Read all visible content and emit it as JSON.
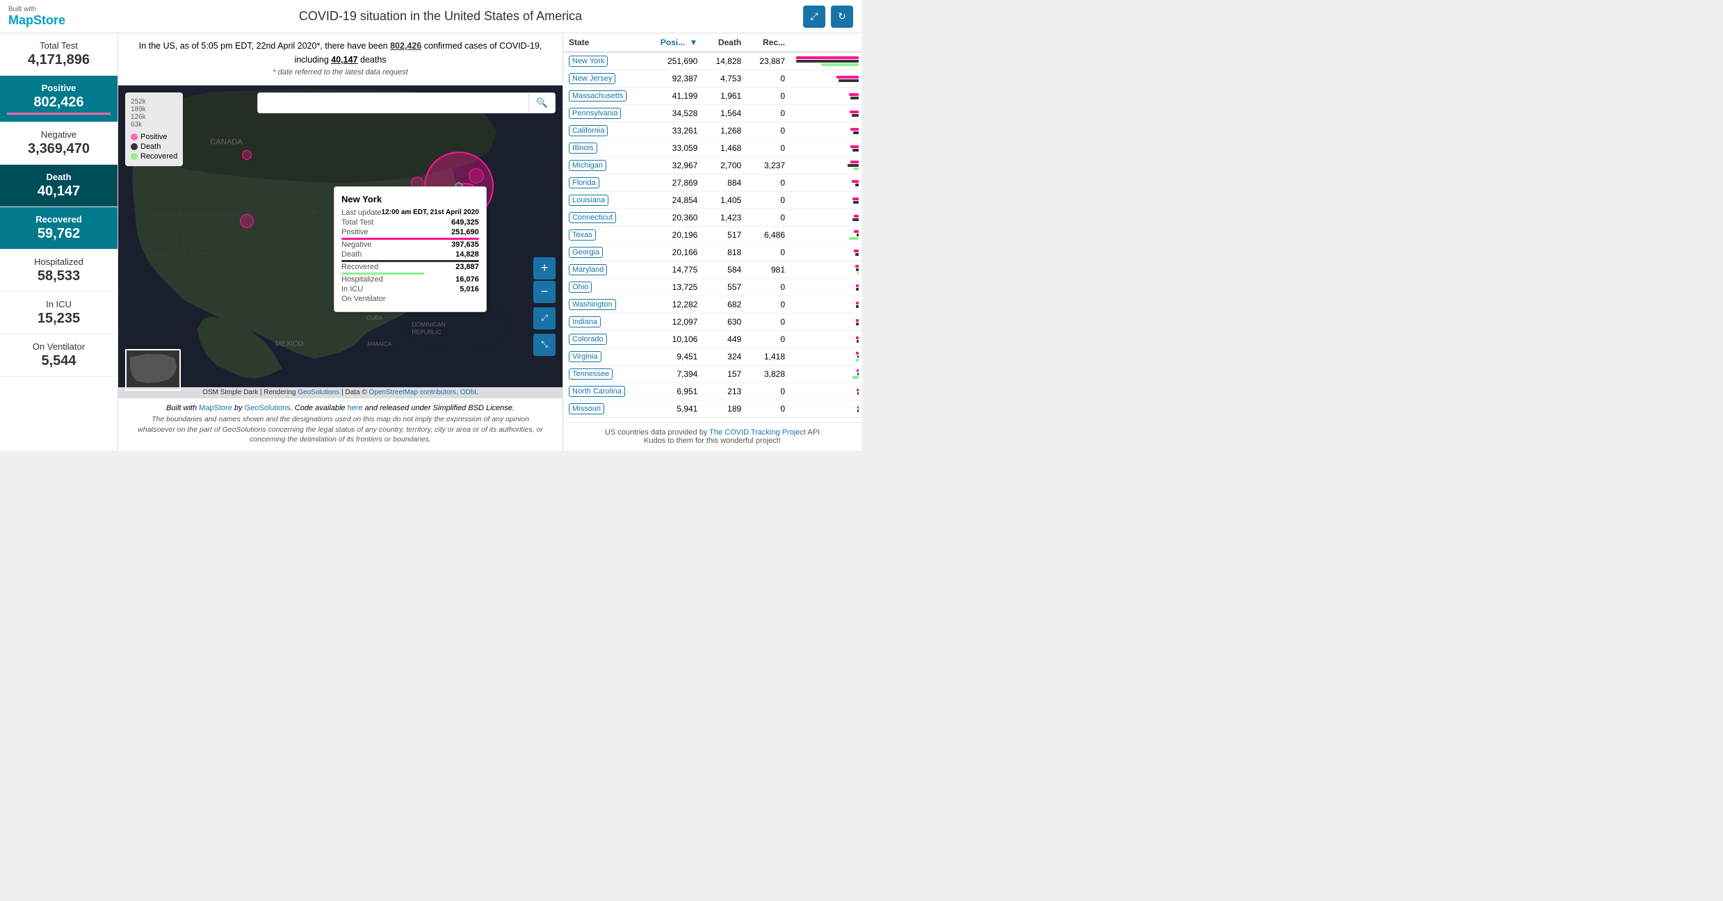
{
  "header": {
    "logo_built": "Built with",
    "logo_name": "MapStore",
    "title": "COVID-19 situation in the United States of America",
    "share_icon": "⤢",
    "refresh_icon": "↻"
  },
  "sidebar": {
    "stats": [
      {
        "label": "Total Test",
        "value": "4,171,896",
        "type": "white"
      },
      {
        "label": "Positive",
        "value": "802,426",
        "type": "teal",
        "accent": "#ff69b4"
      },
      {
        "label": "Negative",
        "value": "3,369,470",
        "type": "white"
      },
      {
        "label": "Death",
        "value": "40,147",
        "type": "dark-teal"
      },
      {
        "label": "Recovered",
        "value": "59,762",
        "type": "teal"
      },
      {
        "label": "Hospitalized",
        "value": "58,533",
        "type": "white"
      },
      {
        "label": "In ICU",
        "value": "15,235",
        "type": "white"
      },
      {
        "label": "On Ventilator",
        "value": "5,544",
        "type": "white"
      }
    ]
  },
  "info_bar": {
    "text": "In the US, as of 5:05 pm EDT, 22nd April 2020*, there have been 802,426 confirmed cases of COVID-19, including 40,147 deaths",
    "confirmed": "802,426",
    "deaths": "40,147",
    "note": "* date referred to the latest data request"
  },
  "map": {
    "search_placeholder": "",
    "tooltip": {
      "state": "New York",
      "last_update_label": "Last update",
      "last_update_value": "12:00 am EDT, 21st April 2020",
      "total_test_label": "Total Test",
      "total_test_value": "649,325",
      "positive_label": "Positive",
      "positive_value": "251,690",
      "negative_label": "Negative",
      "negative_value": "397,635",
      "death_label": "Death",
      "death_value": "14,828",
      "recovered_label": "Recovered",
      "recovered_value": "23,887",
      "hospitalized_label": "Hospitalized",
      "hospitalized_value": "16,076",
      "icu_label": "In ICU",
      "icu_value": "5,016",
      "ventilator_label": "On Ventilator",
      "ventilator_value": ""
    },
    "legend": {
      "scale_labels": [
        "252k",
        "189k",
        "126k",
        "63k"
      ],
      "items": [
        {
          "label": "Positive",
          "color": "pink"
        },
        {
          "label": "Death",
          "color": "black"
        },
        {
          "label": "Recovered",
          "color": "green"
        }
      ]
    },
    "attribution": "OSM Simple Dark | Rendering GeoSolutions | Data © OpenStreetMap contributors, ODbL"
  },
  "table": {
    "columns": [
      {
        "id": "state",
        "label": "State"
      },
      {
        "id": "positive",
        "label": "Posi...",
        "sorted": true
      },
      {
        "id": "death",
        "label": "Death"
      },
      {
        "id": "recovered",
        "label": "Rec..."
      }
    ],
    "rows": [
      {
        "state": "New York",
        "positive": "251,690",
        "death": "14,828",
        "recovered": "23,887",
        "pos_pct": 100,
        "death_pct": 100,
        "rec_pct": 60
      },
      {
        "state": "New Jersey",
        "positive": "92,387",
        "death": "4,753",
        "recovered": "0",
        "pos_pct": 36,
        "death_pct": 32,
        "rec_pct": 0
      },
      {
        "state": "Massachusetts",
        "positive": "41,199",
        "death": "1,961",
        "recovered": "0",
        "pos_pct": 16,
        "death_pct": 13,
        "rec_pct": 0
      },
      {
        "state": "Pennsylvania",
        "positive": "34,528",
        "death": "1,564",
        "recovered": "0",
        "pos_pct": 14,
        "death_pct": 11,
        "rec_pct": 0
      },
      {
        "state": "California",
        "positive": "33,261",
        "death": "1,268",
        "recovered": "0",
        "pos_pct": 13,
        "death_pct": 9,
        "rec_pct": 0
      },
      {
        "state": "Illinois",
        "positive": "33,059",
        "death": "1,468",
        "recovered": "0",
        "pos_pct": 13,
        "death_pct": 10,
        "rec_pct": 0
      },
      {
        "state": "Michigan",
        "positive": "32,967",
        "death": "2,700",
        "recovered": "3,237",
        "pos_pct": 13,
        "death_pct": 18,
        "rec_pct": 8
      },
      {
        "state": "Florida",
        "positive": "27,869",
        "death": "884",
        "recovered": "0",
        "pos_pct": 11,
        "death_pct": 6,
        "rec_pct": 0
      },
      {
        "state": "Louisiana",
        "positive": "24,854",
        "death": "1,405",
        "recovered": "0",
        "pos_pct": 10,
        "death_pct": 9,
        "rec_pct": 0
      },
      {
        "state": "Connecticut",
        "positive": "20,360",
        "death": "1,423",
        "recovered": "0",
        "pos_pct": 8,
        "death_pct": 10,
        "rec_pct": 0
      },
      {
        "state": "Texas",
        "positive": "20,196",
        "death": "517",
        "recovered": "6,486",
        "pos_pct": 8,
        "death_pct": 3,
        "rec_pct": 16
      },
      {
        "state": "Georgia",
        "positive": "20,166",
        "death": "818",
        "recovered": "0",
        "pos_pct": 8,
        "death_pct": 6,
        "rec_pct": 0
      },
      {
        "state": "Maryland",
        "positive": "14,775",
        "death": "584",
        "recovered": "981",
        "pos_pct": 6,
        "death_pct": 4,
        "rec_pct": 2
      },
      {
        "state": "Ohio",
        "positive": "13,725",
        "death": "557",
        "recovered": "0",
        "pos_pct": 5,
        "death_pct": 4,
        "rec_pct": 0
      },
      {
        "state": "Washington",
        "positive": "12,282",
        "death": "682",
        "recovered": "0",
        "pos_pct": 5,
        "death_pct": 5,
        "rec_pct": 0
      },
      {
        "state": "Indiana",
        "positive": "12,097",
        "death": "630",
        "recovered": "0",
        "pos_pct": 5,
        "death_pct": 4,
        "rec_pct": 0
      },
      {
        "state": "Colorado",
        "positive": "10,106",
        "death": "449",
        "recovered": "0",
        "pos_pct": 4,
        "death_pct": 3,
        "rec_pct": 0
      },
      {
        "state": "Virginia",
        "positive": "9,451",
        "death": "324",
        "recovered": "1,418",
        "pos_pct": 4,
        "death_pct": 2,
        "rec_pct": 4
      },
      {
        "state": "Tennessee",
        "positive": "7,394",
        "death": "157",
        "recovered": "3,828",
        "pos_pct": 3,
        "death_pct": 1,
        "rec_pct": 10
      },
      {
        "state": "North Carolina",
        "positive": "6,951",
        "death": "213",
        "recovered": "0",
        "pos_pct": 3,
        "death_pct": 1,
        "rec_pct": 0
      },
      {
        "state": "Missouri",
        "positive": "5,941",
        "death": "189",
        "recovered": "0",
        "pos_pct": 2,
        "death_pct": 1,
        "rec_pct": 0
      }
    ]
  },
  "bottom_bar": {
    "built_text": "Built with",
    "mapstore_link": "MapStore",
    "by_text": " by ",
    "geosolutions_link": "GeoSolutions",
    "code_text": ". Code available ",
    "here_link": "here",
    "license_text": " and released under Simplified BSD License.",
    "disclaimer": "The boundaries and names shown and the designations used on this map do not imply the expression of any opinion whatsoever on the part of GeoSolutions concerning the legal status of any country, territory, city or area or of its authorities, or concerning the delimitation of its frontiers or boundaries."
  },
  "right_footer": {
    "text": "US countries data provided by ",
    "link_text": "The COVID Tracking Project",
    "suffix": " API\nKudos to them for this wonderful project!"
  }
}
